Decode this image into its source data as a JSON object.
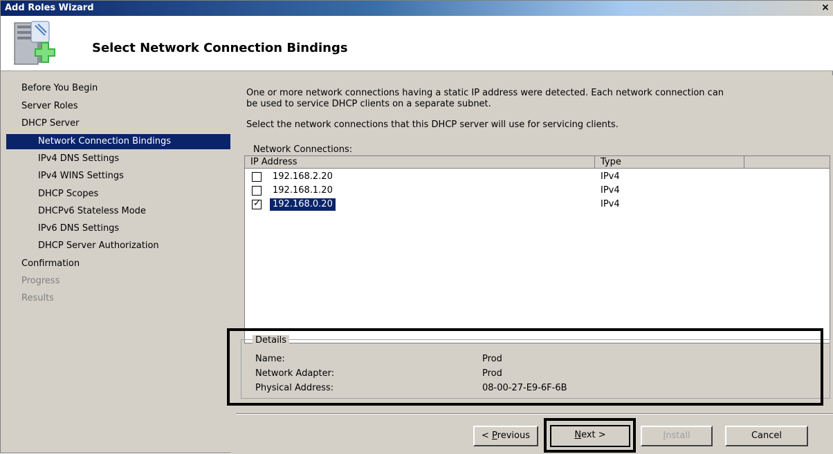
{
  "window": {
    "title": "Add Roles Wizard",
    "close_label": "×"
  },
  "header": {
    "title": "Select Network Connection Bindings"
  },
  "nav": {
    "items": [
      {
        "label": "Before You Begin",
        "level": "top",
        "state": "normal"
      },
      {
        "label": "Server Roles",
        "level": "top",
        "state": "normal"
      },
      {
        "label": "DHCP Server",
        "level": "top",
        "state": "normal"
      },
      {
        "label": "Network Connection Bindings",
        "level": "sub",
        "state": "selected"
      },
      {
        "label": "IPv4 DNS Settings",
        "level": "sub",
        "state": "normal"
      },
      {
        "label": "IPv4 WINS Settings",
        "level": "sub",
        "state": "normal"
      },
      {
        "label": "DHCP Scopes",
        "level": "sub",
        "state": "normal"
      },
      {
        "label": "DHCPv6 Stateless Mode",
        "level": "sub",
        "state": "normal"
      },
      {
        "label": "IPv6 DNS Settings",
        "level": "sub",
        "state": "normal"
      },
      {
        "label": "DHCP Server Authorization",
        "level": "sub",
        "state": "normal"
      },
      {
        "label": "Confirmation",
        "level": "top",
        "state": "normal"
      },
      {
        "label": "Progress",
        "level": "top",
        "state": "disabled"
      },
      {
        "label": "Results",
        "level": "top",
        "state": "disabled"
      }
    ]
  },
  "content": {
    "intro_line1": "One or more network connections having a static IP address were detected. Each network connection can",
    "intro_line2": "be used to service DHCP clients on a separate subnet.",
    "instruction": "Select the network connections that this DHCP server will use for servicing clients.",
    "list_label": "Network Connections:",
    "columns": {
      "ip": "IP Address",
      "type": "Type"
    },
    "rows": [
      {
        "ip": "192.168.2.20",
        "type": "IPv4",
        "checked": false,
        "selected": false
      },
      {
        "ip": "192.168.1.20",
        "type": "IPv4",
        "checked": false,
        "selected": false
      },
      {
        "ip": "192.168.0.20",
        "type": "IPv4",
        "checked": true,
        "selected": true
      }
    ],
    "check_glyph": "✓"
  },
  "details": {
    "legend": "Details",
    "name_label": "Name:",
    "name_value": "Prod",
    "adapter_label": "Network Adapter:",
    "adapter_value": "Prod",
    "mac_label": "Physical Address:",
    "mac_value": "08-00-27-E9-6F-6B"
  },
  "buttons": {
    "previous_prefix": "< ",
    "previous_accel": "P",
    "previous_rest": "revious",
    "next_accel": "N",
    "next_rest": "ext >",
    "install_accel": "I",
    "install_rest": "nstall",
    "cancel": "Cancel"
  },
  "colors": {
    "selection": "#0a246a",
    "face": "#d4d0c8",
    "disabled_text": "#808080"
  }
}
